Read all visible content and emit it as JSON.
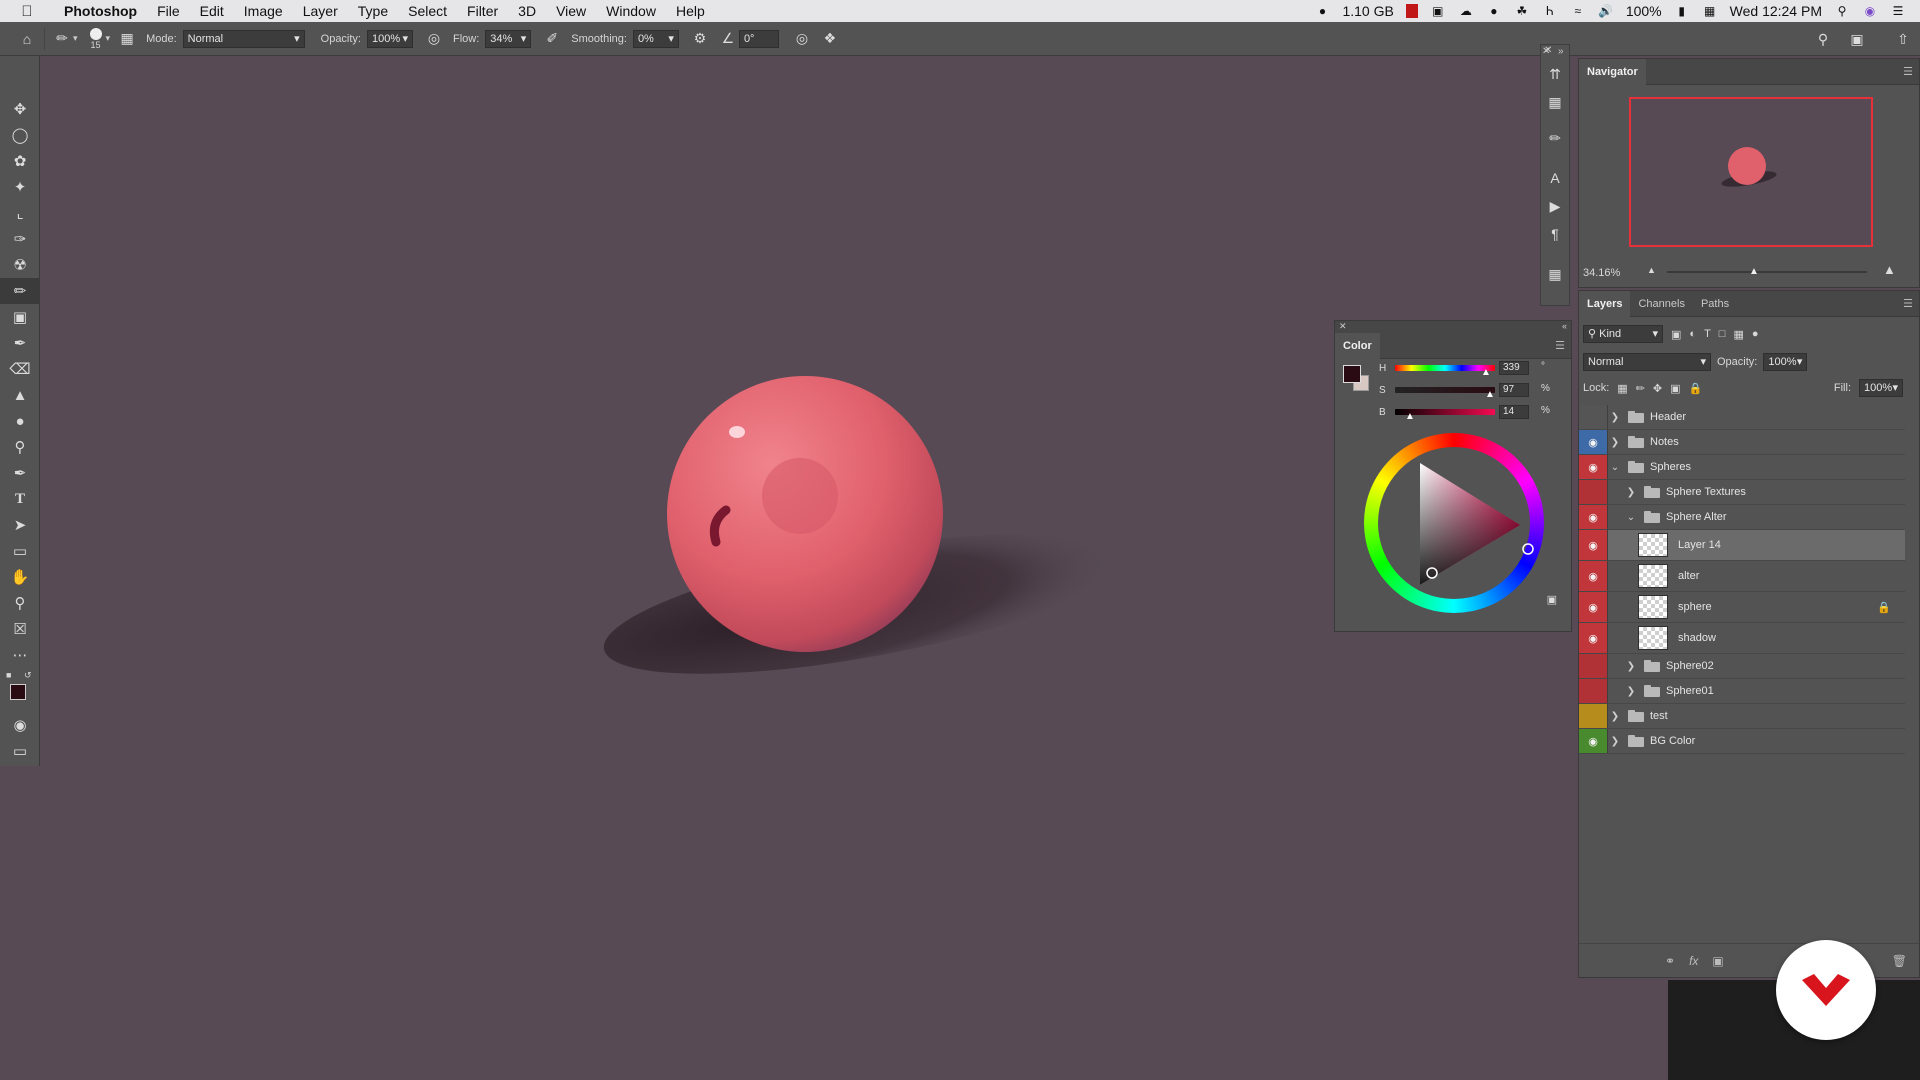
{
  "menubar": {
    "app": "Photoshop",
    "items": [
      "File",
      "Edit",
      "Image",
      "Layer",
      "Type",
      "Select",
      "Filter",
      "3D",
      "View",
      "Window",
      "Help"
    ],
    "memory": "1.10 GB",
    "battery": "100%",
    "clock": "Wed 12:24 PM"
  },
  "options": {
    "brush_size": "15",
    "mode_label": "Mode:",
    "mode_value": "Normal",
    "opacity_label": "Opacity:",
    "opacity_value": "100%",
    "flow_label": "Flow:",
    "flow_value": "34%",
    "smoothing_label": "Smoothing:",
    "smoothing_value": "0%",
    "angle_value": "0°"
  },
  "navigator": {
    "title": "Navigator",
    "zoom": "34.16%"
  },
  "color": {
    "title": "Color",
    "h_label": "H",
    "h_value": "339",
    "h_unit": "°",
    "s_label": "S",
    "s_value": "97",
    "s_unit": "%",
    "b_label": "B",
    "b_value": "14",
    "b_unit": "%",
    "fg_color": "#2a0b13",
    "bg_color": "#d8c8c4"
  },
  "layers_panel": {
    "tabs": [
      "Layers",
      "Channels",
      "Paths"
    ],
    "filter_label": "Kind",
    "blend_mode": "Normal",
    "opacity_label": "Opacity:",
    "opacity_value": "100%",
    "lock_label": "Lock:",
    "fill_label": "Fill:",
    "fill_value": "100%",
    "layers": [
      {
        "name": "Header",
        "type": "group"
      },
      {
        "name": "Notes",
        "type": "group"
      },
      {
        "name": "Spheres",
        "type": "group"
      },
      {
        "name": "Sphere Textures",
        "type": "group"
      },
      {
        "name": "Sphere Alter",
        "type": "group"
      },
      {
        "name": "Layer 14",
        "type": "layer"
      },
      {
        "name": "alter",
        "type": "layer"
      },
      {
        "name": "sphere",
        "type": "layer"
      },
      {
        "name": "shadow",
        "type": "layer"
      },
      {
        "name": "Sphere02",
        "type": "group"
      },
      {
        "name": "Sphere01",
        "type": "group"
      },
      {
        "name": "test",
        "type": "group"
      },
      {
        "name": "BG Color",
        "type": "group"
      }
    ]
  },
  "colors": {
    "canvas_bg": "#574a55",
    "sphere": "#e0606c",
    "label_red": "#c0363a",
    "label_blue": "#3f6aa8",
    "label_yellow": "#b68c1c",
    "label_green": "#4a8a2e"
  }
}
